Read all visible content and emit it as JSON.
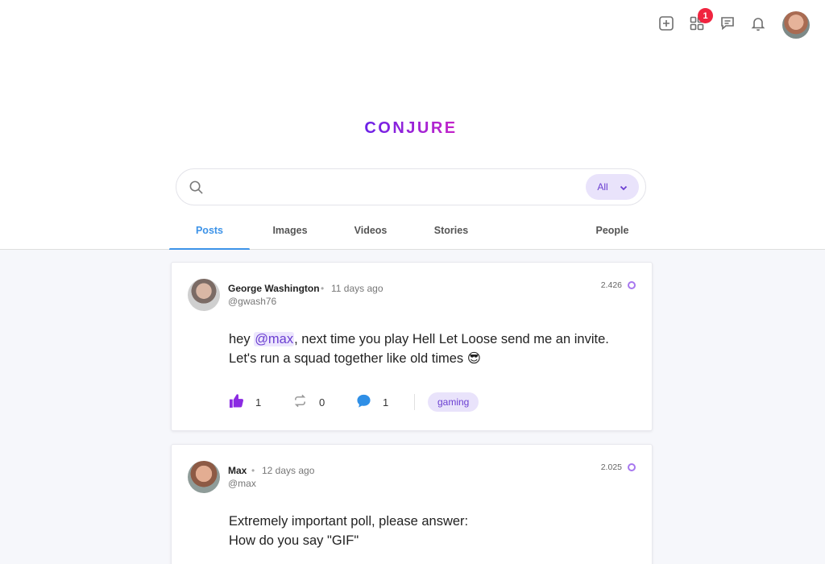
{
  "header": {
    "notification_count": "1",
    "icons": [
      "plus-square-icon",
      "apps-grid-icon",
      "message-icon",
      "bell-icon"
    ]
  },
  "brand": {
    "name": "CONJURE",
    "gradient": [
      "#6a22e8",
      "#c724c8"
    ]
  },
  "search": {
    "placeholder": "",
    "value": "",
    "filter": "All"
  },
  "tabs": [
    {
      "label": "Posts",
      "active": true
    },
    {
      "label": "Images",
      "active": false
    },
    {
      "label": "Videos",
      "active": false
    },
    {
      "label": "Stories",
      "active": false
    },
    {
      "label": "People",
      "active": false
    }
  ],
  "posts": [
    {
      "author": "George Washington",
      "time": "11 days ago",
      "handle": "@gwash76",
      "score": "2.426",
      "text_before": "hey ",
      "mention": "@max",
      "text_after": ", next time you play Hell Let Loose send me an invite.",
      "text_line2": "Let's run a squad together like old times 😎",
      "likes": "1",
      "reposts": "0",
      "comments": "1",
      "tag": "gaming"
    },
    {
      "author": "Max",
      "time": "12 days ago",
      "handle": "@max",
      "score": "2.025",
      "text_line1": "Extremely important poll, please answer:",
      "text_line2": "How do you say \"GIF\""
    }
  ],
  "colors": {
    "accent_blue": "#3d93e8",
    "accent_purple": "#6b3fd1",
    "badge_red": "#f0243f",
    "feed_bg": "#f6f7fb"
  }
}
